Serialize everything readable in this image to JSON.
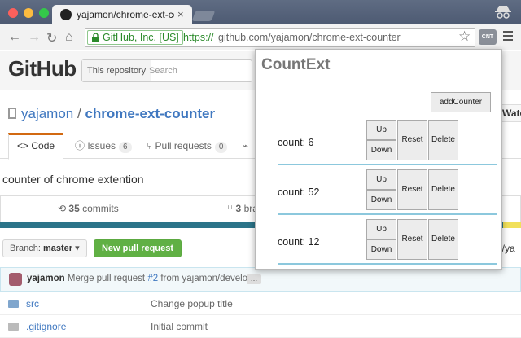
{
  "browser": {
    "tab_title": "yajamon/chrome-ext-counte",
    "tab_close": "×",
    "ev_cert": "GitHub, Inc. [US]",
    "url_scheme": "https://",
    "url_rest": "github.com/yajamon/chrome-ext-counter",
    "ext_badge": "CNT"
  },
  "github": {
    "logo": "GitHub",
    "scope_label": "This repository",
    "search_placeholder": "Search",
    "owner": "yajamon",
    "separator": "/",
    "repo": "chrome-ext-counter",
    "watch": "Watc",
    "tabs": [
      {
        "label": "Code"
      },
      {
        "label": "Issues",
        "count": "6"
      },
      {
        "label": "Pull requests",
        "count": "0"
      }
    ],
    "description": "counter of chrome extention",
    "commits_count": "35",
    "commits_label": "commits",
    "branches_count": "3",
    "branches_label": "bra",
    "branch_prefix": "Branch:",
    "branch_name": "master",
    "new_pr": "New pull request",
    "path_fragment": "n/ya",
    "commit": {
      "author": "yajamon",
      "msg_prefix": "Merge pull request",
      "pr_link": "#2",
      "msg_suffix": "from yajamon/develop",
      "ellipsis": "…"
    },
    "files": [
      {
        "name": "src",
        "message": "Change popup title"
      },
      {
        "name": ".gitignore",
        "message": "Initial commit"
      }
    ]
  },
  "popup": {
    "title": "CountExt",
    "add_label": "addCounter",
    "up_label": "Up",
    "down_label": "Down",
    "reset_label": "Reset",
    "delete_label": "Delete",
    "counters": [
      {
        "label": "count: 6"
      },
      {
        "label": "count: 52"
      },
      {
        "label": "count: 12"
      }
    ]
  }
}
